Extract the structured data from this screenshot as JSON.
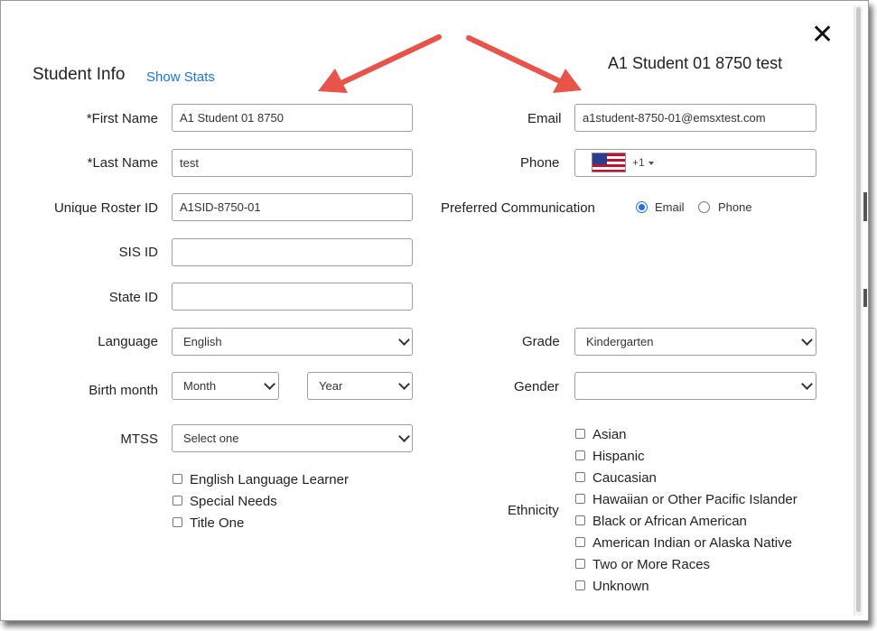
{
  "header": {
    "section_title": "Student Info",
    "show_stats": "Show Stats",
    "student_name": "A1 Student 01 8750 test"
  },
  "colors": {
    "accent": "#1a73e8",
    "arrow": "#e8534a"
  },
  "form": {
    "first_name": {
      "label": "*First Name",
      "value": "A1 Student 01 8750"
    },
    "last_name": {
      "label": "*Last Name",
      "value": "test"
    },
    "unique_roster_id": {
      "label": "Unique Roster ID",
      "value": "A1SID-8750-01"
    },
    "sis_id": {
      "label": "SIS ID",
      "value": ""
    },
    "state_id": {
      "label": "State ID",
      "value": ""
    },
    "language": {
      "label": "Language",
      "value": "English"
    },
    "birth_month": {
      "label": "Birth month",
      "month": "Month",
      "year": "Year"
    },
    "mtss": {
      "label": "MTSS",
      "value": "Select one"
    },
    "programs": [
      "English Language Learner",
      "Special Needs",
      "Title One"
    ],
    "email": {
      "label": "Email",
      "value": "a1student-8750-01@emsxtest.com"
    },
    "phone": {
      "label": "Phone",
      "country_code": "+1",
      "flag_icon": "us-flag-icon"
    },
    "preferred_communication": {
      "label": "Preferred Communication",
      "options": [
        "Email",
        "Phone"
      ],
      "selected": "Email"
    },
    "grade": {
      "label": "Grade",
      "value": "Kindergarten"
    },
    "gender": {
      "label": "Gender",
      "value": ""
    },
    "ethnicity": {
      "label": "Ethnicity",
      "options": [
        "Asian",
        "Hispanic",
        "Caucasian",
        "Hawaiian or Other Pacific Islander",
        "Black or African American",
        "American Indian or Alaska Native",
        "Two or More Races",
        "Unknown"
      ]
    }
  }
}
